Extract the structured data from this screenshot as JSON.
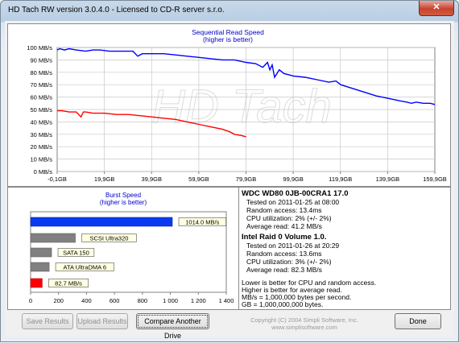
{
  "window": {
    "title": "HD Tach RW version 3.0.4.0 - Licensed to CD-R server s.r.o.",
    "close_glyph": "✕"
  },
  "sequential": {
    "title": "Sequential Read Speed",
    "subtitle": "(higher is better)",
    "watermark": "HD Tach",
    "y_ticks": [
      "0 MB/s",
      "10 MB/s",
      "20 MB/s",
      "30 MB/s",
      "40 MB/s",
      "50 MB/s",
      "60 MB/s",
      "70 MB/s",
      "80 MB/s",
      "90 MB/s",
      "100 MB/s"
    ],
    "x_ticks": [
      "-0,1GB",
      "19,9GB",
      "39,9GB",
      "59,9GB",
      "79,9GB",
      "99,9GB",
      "119,9GB",
      "139,9GB",
      "159,9GB"
    ]
  },
  "burst": {
    "title": "Burst Speed",
    "subtitle": "(higher is better)",
    "x_ticks": [
      "0",
      "200",
      "400",
      "600",
      "800",
      "1 000",
      "1 200",
      "1 400"
    ]
  },
  "chart_data": [
    {
      "type": "line",
      "title": "Sequential Read Speed",
      "subtitle": "(higher is better)",
      "xlabel": "",
      "ylabel": "",
      "xlim": [
        -0.1,
        159.9
      ],
      "ylim": [
        0,
        100
      ],
      "grid": true,
      "series": [
        {
          "color": "#0000ff",
          "x": [
            -0.1,
            1,
            3,
            5,
            8,
            12,
            15,
            18,
            22,
            26,
            30,
            32,
            34,
            36,
            40,
            45,
            50,
            55,
            60,
            65,
            70,
            75,
            80,
            84,
            87,
            89,
            90,
            91,
            92,
            94,
            96,
            100,
            105,
            110,
            115,
            118,
            120,
            125,
            130,
            135,
            140,
            145,
            148,
            150,
            152,
            155,
            158,
            159.9
          ],
          "y": [
            98,
            99,
            98,
            99,
            98,
            97,
            98,
            98,
            97,
            97,
            97,
            97,
            93,
            95,
            95,
            95,
            94,
            93,
            92,
            91,
            90,
            90,
            88,
            87,
            84,
            88,
            82,
            86,
            76,
            82,
            79,
            77,
            76,
            74,
            72,
            73,
            70,
            67,
            64,
            61,
            59,
            57,
            56,
            55,
            56,
            55,
            55,
            54
          ]
        },
        {
          "color": "#ff0000",
          "x": [
            -0.1,
            2,
            5,
            8,
            10,
            11,
            12,
            15,
            20,
            25,
            30,
            35,
            40,
            45,
            50,
            55,
            60,
            65,
            70,
            73,
            75,
            78,
            79.9
          ],
          "y": [
            49,
            49,
            48,
            48,
            44,
            48,
            48,
            47,
            47,
            46,
            46,
            45,
            44,
            43,
            42,
            40,
            38,
            36,
            34,
            32,
            30,
            29,
            28
          ]
        }
      ]
    },
    {
      "type": "bar",
      "title": "Burst Speed",
      "subtitle": "(higher is better)",
      "xlim": [
        0,
        1400
      ],
      "categories": [
        "1014.0 MB/s",
        "SCSI Ultra320",
        "SATA 150",
        "ATA UltraDMA 6",
        "82.7 MB/s"
      ],
      "values": [
        1014.0,
        320,
        150,
        133,
        82.7
      ],
      "colors": [
        "#0a3af0",
        "#808080",
        "#808080",
        "#808080",
        "#ff0000"
      ]
    }
  ],
  "drives": [
    {
      "name": "WDC WD80 0JB-00CRA1 17.0",
      "color": "#ff0000",
      "lines": [
        "Tested on 2011-01-25 at 08:00",
        "Random access: 13.4ms",
        "CPU utilization: 2% (+/- 2%)",
        "Average read: 41.2 MB/s"
      ]
    },
    {
      "name": "Intel Raid 0 Volume 1.0.",
      "color": "#0000ff",
      "lines": [
        "Tested on 2011-01-26 at 20:29",
        "Random access: 13.6ms",
        "CPU utilization: 3% (+/- 2%)",
        "Average read: 82.3 MB/s"
      ]
    }
  ],
  "notes": [
    "Lower is better for CPU and random access.",
    "Higher is better for average read.",
    "MB/s = 1,000,000 bytes per second.",
    "GB = 1,000,000,000 bytes."
  ],
  "buttons": {
    "save": "Save Results",
    "upload": "Upload Results",
    "compare": "Compare Another Drive",
    "done": "Done"
  },
  "copyright": "Copyright (C) 2004 Simpli Software, Inc. www.simplisoftware.com"
}
